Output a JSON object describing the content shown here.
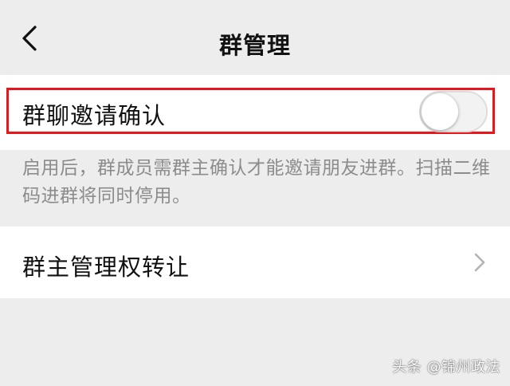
{
  "nav": {
    "title": "群管理",
    "back_icon": "chevron-left-icon"
  },
  "invite_confirm": {
    "label": "群聊邀请确认",
    "enabled": false,
    "highlight_color": "#e8161b"
  },
  "description": "启用后，群成员需群主确认才能邀请朋友进群。扫描二维码进群将同时停用。",
  "transfer_owner": {
    "label": "群主管理权转让",
    "icon": "chevron-right-icon"
  },
  "watermark": "头条 @锦州政法"
}
